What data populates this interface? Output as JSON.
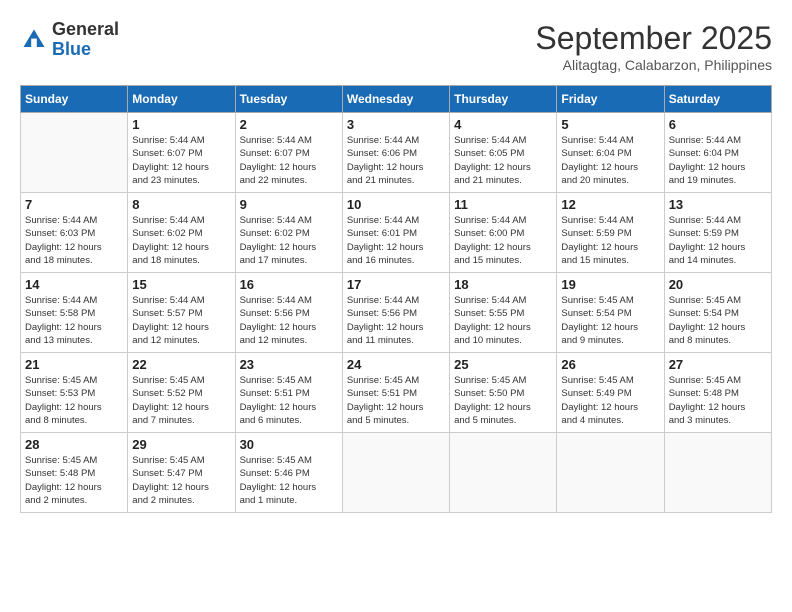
{
  "header": {
    "logo_general": "General",
    "logo_blue": "Blue",
    "month": "September 2025",
    "location": "Alitagtag, Calabarzon, Philippines"
  },
  "days_of_week": [
    "Sunday",
    "Monday",
    "Tuesday",
    "Wednesday",
    "Thursday",
    "Friday",
    "Saturday"
  ],
  "weeks": [
    [
      {
        "day": "",
        "info": ""
      },
      {
        "day": "1",
        "info": "Sunrise: 5:44 AM\nSunset: 6:07 PM\nDaylight: 12 hours\nand 23 minutes."
      },
      {
        "day": "2",
        "info": "Sunrise: 5:44 AM\nSunset: 6:07 PM\nDaylight: 12 hours\nand 22 minutes."
      },
      {
        "day": "3",
        "info": "Sunrise: 5:44 AM\nSunset: 6:06 PM\nDaylight: 12 hours\nand 21 minutes."
      },
      {
        "day": "4",
        "info": "Sunrise: 5:44 AM\nSunset: 6:05 PM\nDaylight: 12 hours\nand 21 minutes."
      },
      {
        "day": "5",
        "info": "Sunrise: 5:44 AM\nSunset: 6:04 PM\nDaylight: 12 hours\nand 20 minutes."
      },
      {
        "day": "6",
        "info": "Sunrise: 5:44 AM\nSunset: 6:04 PM\nDaylight: 12 hours\nand 19 minutes."
      }
    ],
    [
      {
        "day": "7",
        "info": "Sunrise: 5:44 AM\nSunset: 6:03 PM\nDaylight: 12 hours\nand 18 minutes."
      },
      {
        "day": "8",
        "info": "Sunrise: 5:44 AM\nSunset: 6:02 PM\nDaylight: 12 hours\nand 18 minutes."
      },
      {
        "day": "9",
        "info": "Sunrise: 5:44 AM\nSunset: 6:02 PM\nDaylight: 12 hours\nand 17 minutes."
      },
      {
        "day": "10",
        "info": "Sunrise: 5:44 AM\nSunset: 6:01 PM\nDaylight: 12 hours\nand 16 minutes."
      },
      {
        "day": "11",
        "info": "Sunrise: 5:44 AM\nSunset: 6:00 PM\nDaylight: 12 hours\nand 15 minutes."
      },
      {
        "day": "12",
        "info": "Sunrise: 5:44 AM\nSunset: 5:59 PM\nDaylight: 12 hours\nand 15 minutes."
      },
      {
        "day": "13",
        "info": "Sunrise: 5:44 AM\nSunset: 5:59 PM\nDaylight: 12 hours\nand 14 minutes."
      }
    ],
    [
      {
        "day": "14",
        "info": "Sunrise: 5:44 AM\nSunset: 5:58 PM\nDaylight: 12 hours\nand 13 minutes."
      },
      {
        "day": "15",
        "info": "Sunrise: 5:44 AM\nSunset: 5:57 PM\nDaylight: 12 hours\nand 12 minutes."
      },
      {
        "day": "16",
        "info": "Sunrise: 5:44 AM\nSunset: 5:56 PM\nDaylight: 12 hours\nand 12 minutes."
      },
      {
        "day": "17",
        "info": "Sunrise: 5:44 AM\nSunset: 5:56 PM\nDaylight: 12 hours\nand 11 minutes."
      },
      {
        "day": "18",
        "info": "Sunrise: 5:44 AM\nSunset: 5:55 PM\nDaylight: 12 hours\nand 10 minutes."
      },
      {
        "day": "19",
        "info": "Sunrise: 5:45 AM\nSunset: 5:54 PM\nDaylight: 12 hours\nand 9 minutes."
      },
      {
        "day": "20",
        "info": "Sunrise: 5:45 AM\nSunset: 5:54 PM\nDaylight: 12 hours\nand 8 minutes."
      }
    ],
    [
      {
        "day": "21",
        "info": "Sunrise: 5:45 AM\nSunset: 5:53 PM\nDaylight: 12 hours\nand 8 minutes."
      },
      {
        "day": "22",
        "info": "Sunrise: 5:45 AM\nSunset: 5:52 PM\nDaylight: 12 hours\nand 7 minutes."
      },
      {
        "day": "23",
        "info": "Sunrise: 5:45 AM\nSunset: 5:51 PM\nDaylight: 12 hours\nand 6 minutes."
      },
      {
        "day": "24",
        "info": "Sunrise: 5:45 AM\nSunset: 5:51 PM\nDaylight: 12 hours\nand 5 minutes."
      },
      {
        "day": "25",
        "info": "Sunrise: 5:45 AM\nSunset: 5:50 PM\nDaylight: 12 hours\nand 5 minutes."
      },
      {
        "day": "26",
        "info": "Sunrise: 5:45 AM\nSunset: 5:49 PM\nDaylight: 12 hours\nand 4 minutes."
      },
      {
        "day": "27",
        "info": "Sunrise: 5:45 AM\nSunset: 5:48 PM\nDaylight: 12 hours\nand 3 minutes."
      }
    ],
    [
      {
        "day": "28",
        "info": "Sunrise: 5:45 AM\nSunset: 5:48 PM\nDaylight: 12 hours\nand 2 minutes."
      },
      {
        "day": "29",
        "info": "Sunrise: 5:45 AM\nSunset: 5:47 PM\nDaylight: 12 hours\nand 2 minutes."
      },
      {
        "day": "30",
        "info": "Sunrise: 5:45 AM\nSunset: 5:46 PM\nDaylight: 12 hours\nand 1 minute."
      },
      {
        "day": "",
        "info": ""
      },
      {
        "day": "",
        "info": ""
      },
      {
        "day": "",
        "info": ""
      },
      {
        "day": "",
        "info": ""
      }
    ]
  ]
}
